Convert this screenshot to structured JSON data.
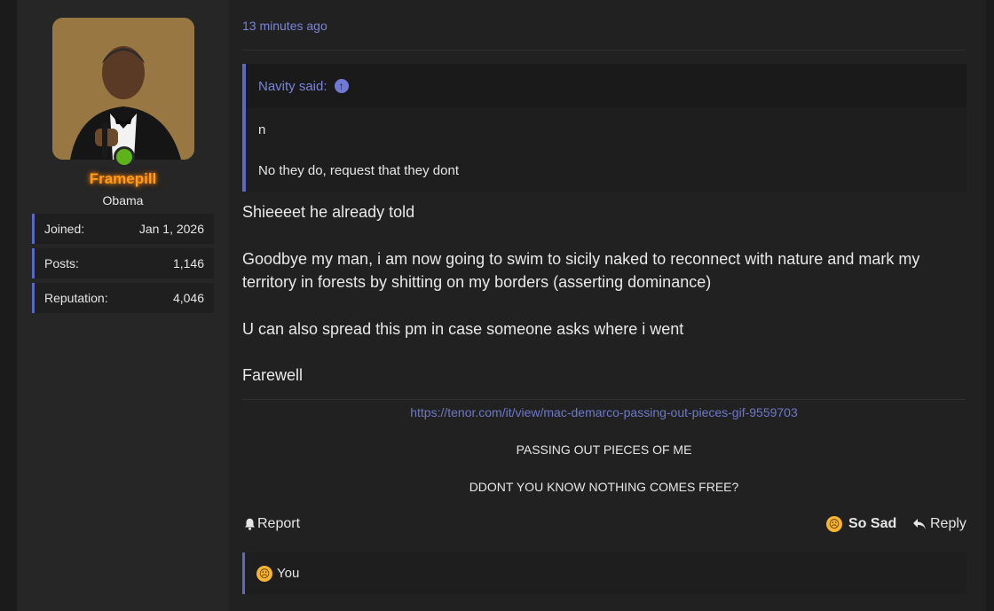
{
  "user": {
    "name": "Framepill",
    "title": "Obama",
    "stats": [
      {
        "label": "Joined:",
        "value": "Jan 1, 2026"
      },
      {
        "label": "Posts:",
        "value": "1,146"
      },
      {
        "label": "Reputation:",
        "value": "4,046"
      }
    ]
  },
  "post": {
    "time": "13 minutes ago",
    "quote": {
      "author": "Navity said:",
      "lines": [
        "n",
        "No they do, request that they dont"
      ]
    },
    "body": [
      "Shieeeet he already told",
      "Goodbye my man, i am now going to swim to sicily naked to reconnect with nature and mark my",
      "territory in forests by shitting on my borders (asserting dominance)",
      "U can also spread this pm in case someone asks where i went",
      "Farewell"
    ],
    "embed": {
      "link": "https://tenor.com/it/view/mac-demarco-passing-out-pieces-gif-9559703",
      "line1": "PASSING OUT PIECES OF ME",
      "line2": "DDONT YOU KNOW NOTHING COMES FREE?"
    }
  },
  "actions": {
    "report": "Report",
    "reaction": "So Sad",
    "reply": "Reply"
  },
  "reactions": {
    "text": "You"
  },
  "colors": {
    "accent": "#5b68c8",
    "link": "#6e78c9",
    "username": "#ff9c1a",
    "online": "#5fb31a"
  }
}
